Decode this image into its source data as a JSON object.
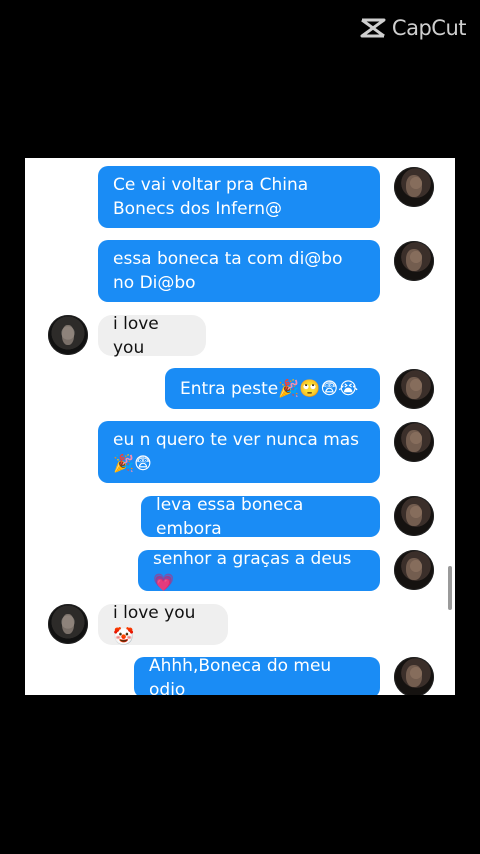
{
  "watermark": {
    "brand": "CapCut"
  },
  "messages": [
    {
      "side": "sent",
      "text": "Ce vai voltar pra China Bonecs dos Infern@"
    },
    {
      "side": "sent",
      "text": "essa boneca ta com di@bo no Di@bo"
    },
    {
      "side": "recv",
      "text": "i love you"
    },
    {
      "side": "sent",
      "text": "Entra peste🎉🙄😨😭"
    },
    {
      "side": "sent",
      "text": "eu n quero te ver nunca mas 🎉😨"
    },
    {
      "side": "sent",
      "text": "leva essa boneca embora"
    },
    {
      "side": "sent",
      "text": "senhor a graças a deus💗"
    },
    {
      "side": "recv",
      "text": "i love you🤡"
    },
    {
      "side": "sent",
      "text": "Ahhh,Boneca do meu odio"
    }
  ]
}
